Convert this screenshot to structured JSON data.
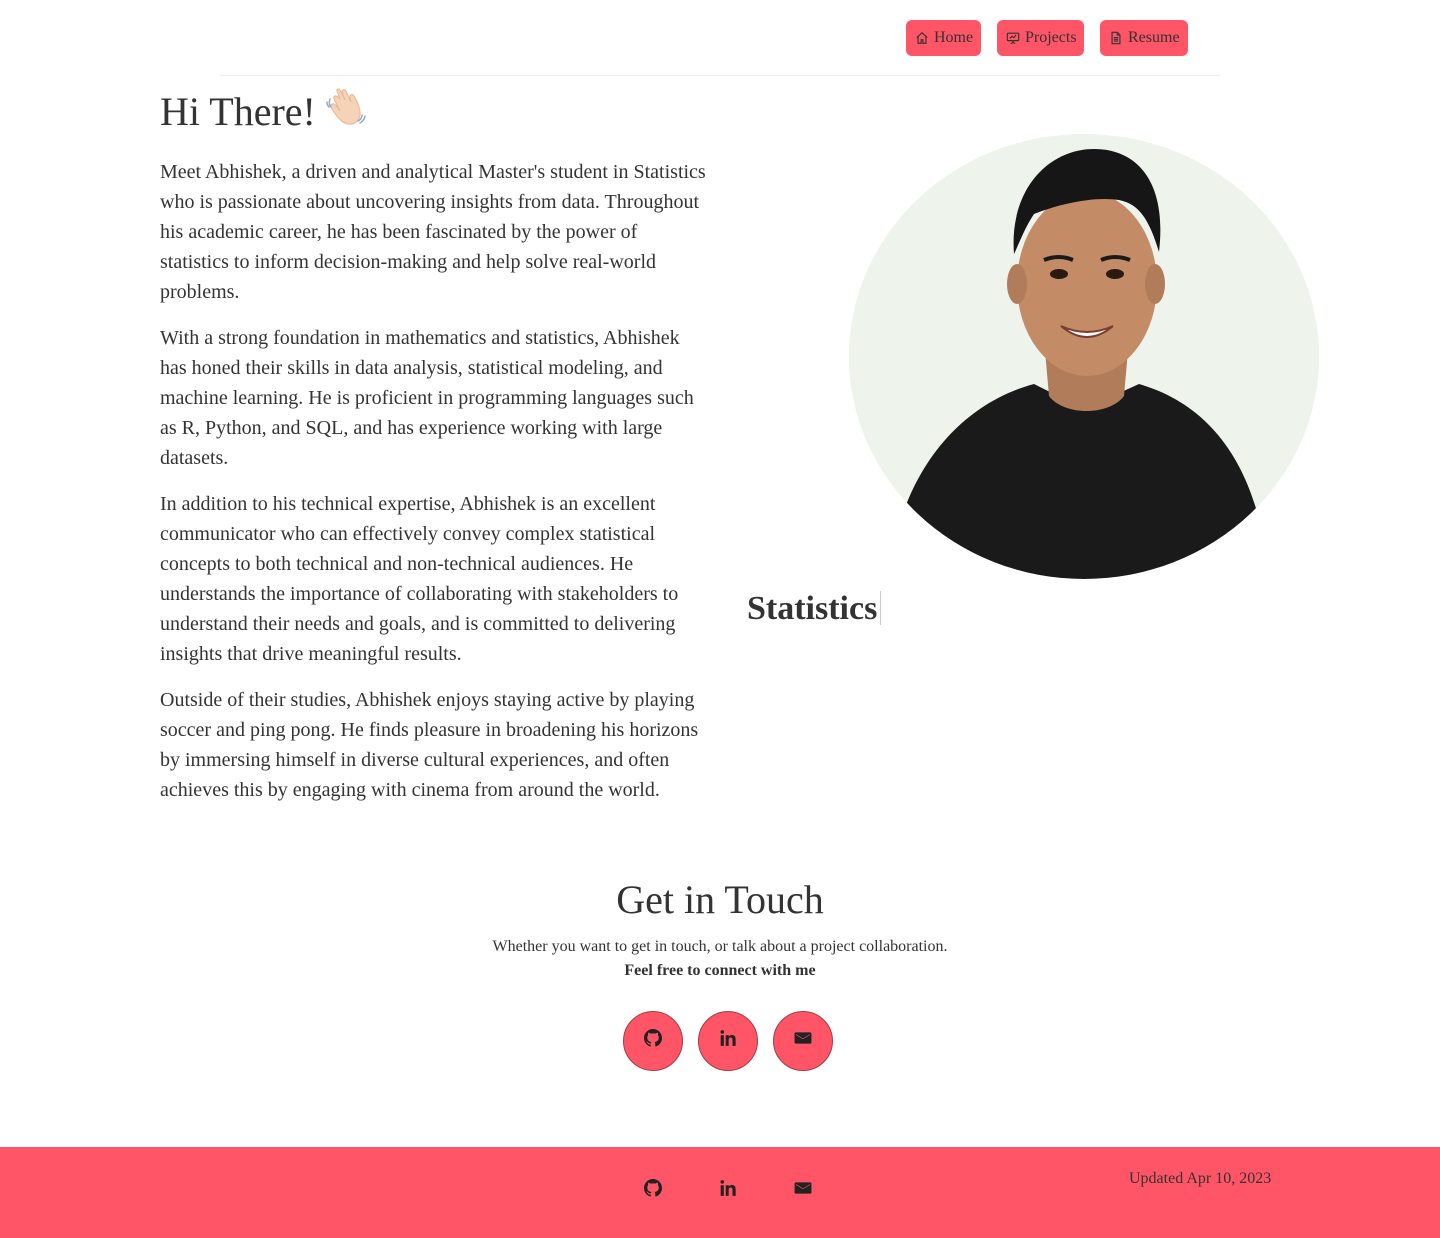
{
  "nav": {
    "home_label": "Home",
    "projects_label": "Projects",
    "resume_label": "Resume",
    "accent": "#ff5566"
  },
  "hero": {
    "title": "Hi There!",
    "bio": [
      "Meet Abhishek, a driven and analytical Master's student in Statistics who is passionate about uncovering insights from data. Throughout his academic career, he has been fascinated by the power of statistics to inform decision-making and help solve real-world problems.",
      "With a strong foundation in mathematics and statistics, Abhishek has honed their skills in data analysis, statistical modeling, and machine learning. He is proficient in programming languages such as R, Python, and SQL, and has experience working with large datasets.",
      "In addition to his technical expertise, Abhishek is an excellent communicator who can effectively convey complex statistical concepts to both technical and non-technical audiences. He understands the importance of collaborating with stakeholders to understand their needs and goals, and is committed to delivering insights that drive meaningful results.",
      "Outside of their studies, Abhishek enjoys staying active by playing soccer and ping pong. He finds pleasure in broadening his horizons by immersing himself in diverse cultural experiences, and often achieves this by engaging with cinema from around the world."
    ],
    "typed_text": "Statistics"
  },
  "contact": {
    "title": "Get in Touch",
    "subtitle": "Whether you want to get in touch, or talk about a project collaboration.",
    "cta": "Feel free to connect with me",
    "icons": [
      "github-icon",
      "linkedin-icon",
      "mail-icon"
    ]
  },
  "footer": {
    "updated": "Updated Apr 10, 2023",
    "background": "#ff5566"
  }
}
